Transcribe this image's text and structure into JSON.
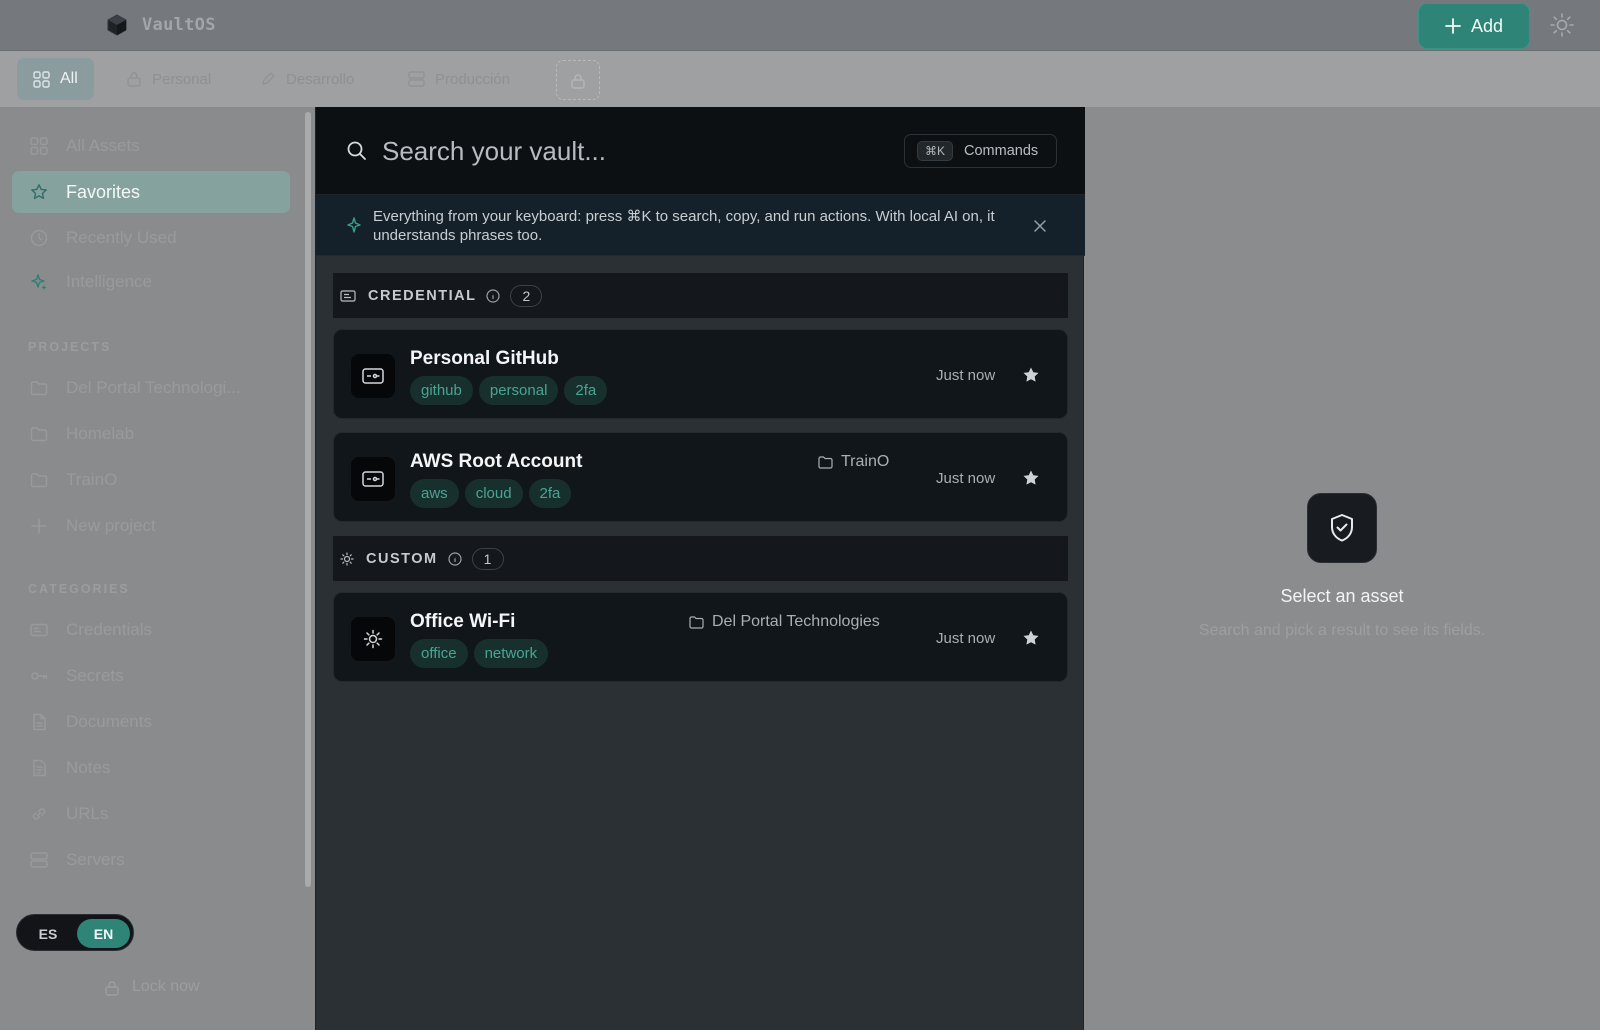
{
  "app": {
    "name": "VaultOS"
  },
  "topbar": {
    "add_label": "Add"
  },
  "tabs": [
    {
      "label": "All",
      "active": true
    },
    {
      "label": "Personal"
    },
    {
      "label": "Desarrollo"
    },
    {
      "label": "Producción"
    }
  ],
  "sidebar": {
    "nav": [
      {
        "label": "All Assets"
      },
      {
        "label": "Favorites",
        "active": true
      },
      {
        "label": "Recently Used"
      },
      {
        "label": "Intelligence"
      }
    ],
    "projects_title": "PROJECTS",
    "projects": [
      {
        "label": "Del Portal Technologi..."
      },
      {
        "label": "Homelab"
      },
      {
        "label": "TrainO"
      },
      {
        "label": "New project"
      }
    ],
    "categories_title": "CATEGORIES",
    "categories": [
      {
        "label": "Credentials"
      },
      {
        "label": "Secrets"
      },
      {
        "label": "Documents"
      },
      {
        "label": "Notes"
      },
      {
        "label": "URLs"
      },
      {
        "label": "Servers"
      }
    ],
    "lang": {
      "es": "ES",
      "en": "EN",
      "selected": "EN"
    },
    "lock_label": "Lock now"
  },
  "palette": {
    "search_placeholder": "Search your vault...",
    "commands_kbd": "⌘K",
    "commands_label": "Commands",
    "hint": "Everything from your keyboard: press ⌘K to search, copy, and run actions. With local AI on, it understands phrases too.",
    "groups": [
      {
        "label": "CREDENTIAL",
        "count": "2",
        "items": [
          {
            "title": "Personal GitHub",
            "tags": [
              "github",
              "personal",
              "2fa"
            ],
            "project": "",
            "time": "Just now"
          },
          {
            "title": "AWS Root Account",
            "tags": [
              "aws",
              "cloud",
              "2fa"
            ],
            "project": "TrainO",
            "time": "Just now"
          }
        ]
      },
      {
        "label": "CUSTOM",
        "count": "1",
        "items": [
          {
            "title": "Office Wi-Fi",
            "tags": [
              "office",
              "network"
            ],
            "project": "Del Portal Technologies",
            "time": "Just now"
          }
        ]
      }
    ]
  },
  "detail": {
    "title": "Select an asset",
    "subtitle": "Search and pick a result to see its fields."
  },
  "colors": {
    "accent": "#2e8476",
    "tag_text": "#4aa493",
    "tag_bg": "#18302d"
  }
}
